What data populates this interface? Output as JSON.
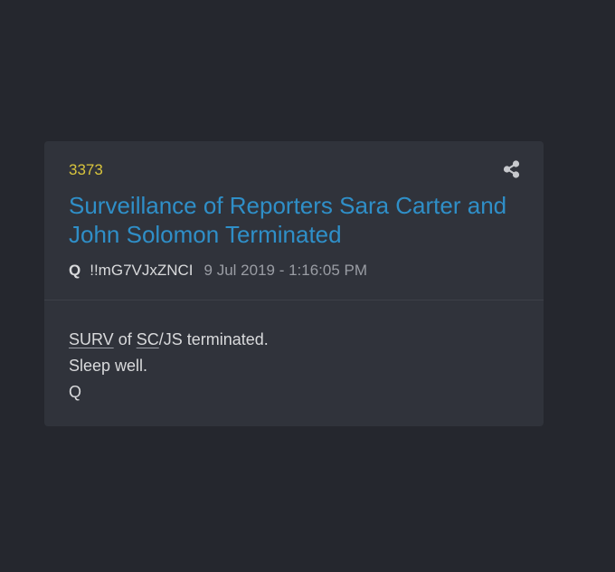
{
  "post": {
    "number": "3373",
    "title": "Surveillance of Reporters Sara Carter and John Solomon Terminated",
    "author": "Q",
    "tripcode": "!!mG7VJxZNCI",
    "date": "9 Jul 2019 - 1:16:05 PM",
    "share_icon": "share-icon"
  },
  "body": {
    "line1": {
      "abbr1": "SURV",
      "text1": " of ",
      "abbr2": "SC",
      "text2": "/JS terminated."
    },
    "line2": "Sleep well.",
    "line3": "Q"
  },
  "colors": {
    "background": "#25272e",
    "card": "#30333b",
    "number": "#d8c43c",
    "title": "#2f8fc8",
    "text": "#d9dadc",
    "date": "#9a9da4"
  }
}
